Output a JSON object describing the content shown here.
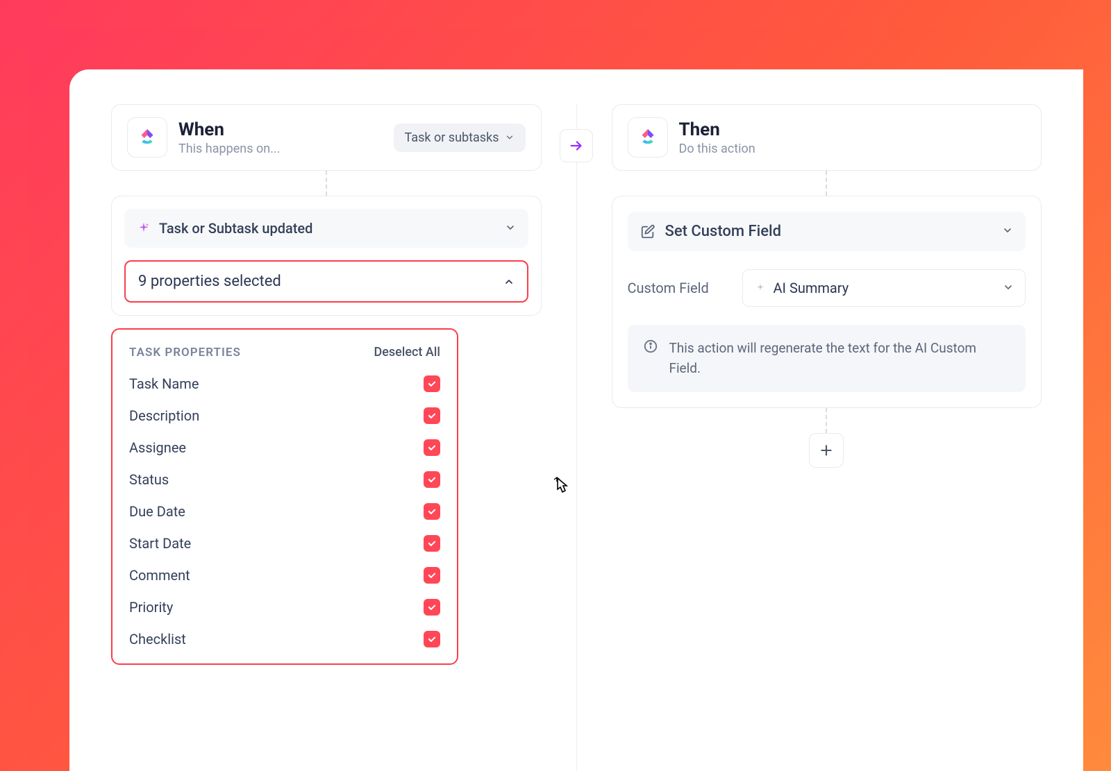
{
  "when": {
    "title": "When",
    "subtitle": "This happens on...",
    "scope": "Task or subtasks",
    "trigger": "Task or Subtask updated",
    "properties_summary": "9 properties selected",
    "dropdown": {
      "heading": "TASK PROPERTIES",
      "deselect": "Deselect All",
      "items": [
        {
          "label": "Task Name",
          "checked": true
        },
        {
          "label": "Description",
          "checked": true
        },
        {
          "label": "Assignee",
          "checked": true
        },
        {
          "label": "Status",
          "checked": true
        },
        {
          "label": "Due Date",
          "checked": true
        },
        {
          "label": "Start Date",
          "checked": true
        },
        {
          "label": "Comment",
          "checked": true
        },
        {
          "label": "Priority",
          "checked": true
        },
        {
          "label": "Checklist",
          "checked": true
        }
      ]
    }
  },
  "then": {
    "title": "Then",
    "subtitle": "Do this action",
    "action": "Set Custom Field",
    "field_label": "Custom Field",
    "field_value": "AI Summary",
    "info": "This action will regenerate the text for the AI Custom Field."
  }
}
